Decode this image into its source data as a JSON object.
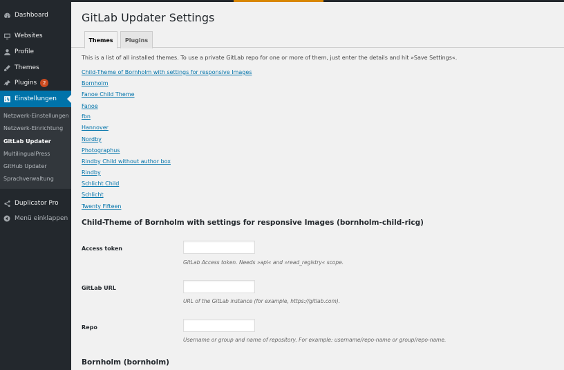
{
  "sidebar": {
    "items": [
      {
        "label": "Dashboard",
        "icon": "dashboard-icon"
      },
      {
        "label": "Websites",
        "icon": "websites-icon"
      },
      {
        "label": "Profile",
        "icon": "profile-icon"
      },
      {
        "label": "Themes",
        "icon": "themes-icon"
      },
      {
        "label": "Plugins",
        "icon": "plugins-icon",
        "badge": "2"
      },
      {
        "label": "Einstellungen",
        "icon": "settings-icon"
      }
    ],
    "submenu": [
      {
        "label": "Netzwerk-Einstellungen"
      },
      {
        "label": "Netzwerk-Einrichtung"
      },
      {
        "label": "GitLab Updater"
      },
      {
        "label": "MultilingualPress"
      },
      {
        "label": "GitHub Updater"
      },
      {
        "label": "Sprachverwaltung"
      }
    ],
    "bottom": [
      {
        "label": "Duplicator Pro",
        "icon": "duplicator-icon"
      },
      {
        "label": "Menü einklappen",
        "icon": "collapse-icon"
      }
    ],
    "active_color": "#0073aa",
    "badge_color": "#ca4a1f"
  },
  "page": {
    "title": "GitLab Updater Settings",
    "tabs": [
      {
        "label": "Themes",
        "active": true
      },
      {
        "label": "Plugins",
        "active": false
      }
    ],
    "intro": "This is a list of all installed themes. To use a private GitLab repo for one or more of them, just enter the details and hit »Save Settings«.",
    "themes": [
      "Child-Theme of Bornholm with settings for responsive Images",
      "Bornholm",
      "Fanoe Child Theme",
      "Fanoe",
      "fbn",
      "Hannover",
      "Nordby",
      "Photographus",
      "Rindby Child without author box",
      "Rindby",
      "Schlicht Child",
      "Schlicht",
      "Twenty Fifteen"
    ],
    "section_title": "Child-Theme of Bornholm with settings for responsive Images (bornholm-child-ricg)",
    "fields": [
      {
        "label": "Access token",
        "value": "",
        "description": "GitLab Access token. Needs »api« and »read_registry« scope."
      },
      {
        "label": "GitLab URL",
        "value": "",
        "description": "URL of the GitLab instance (for example, https://gitlab.com)."
      },
      {
        "label": "Repo",
        "value": "",
        "description": "Username or group and name of repository. For example: username/repo-name or group/repo-name."
      }
    ],
    "next_section_title": "Bornholm (bornholm)",
    "link_color": "#0073aa"
  }
}
